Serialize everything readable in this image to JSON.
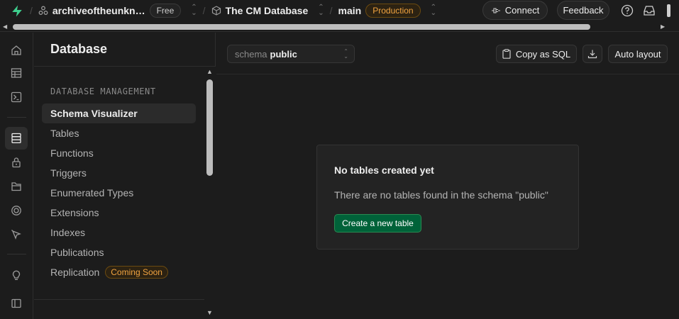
{
  "topbar": {
    "org_name": "archiveoftheunkn…",
    "org_plan": "Free",
    "project_name": "The CM Database",
    "branch_name": "main",
    "branch_env": "Production",
    "connect_label": "Connect",
    "feedback_label": "Feedback"
  },
  "sidemenu": {
    "title": "Database",
    "section_label": "DATABASE MANAGEMENT",
    "items": [
      {
        "label": "Schema Visualizer",
        "active": true
      },
      {
        "label": "Tables"
      },
      {
        "label": "Functions"
      },
      {
        "label": "Triggers"
      },
      {
        "label": "Enumerated Types"
      },
      {
        "label": "Extensions"
      },
      {
        "label": "Indexes"
      },
      {
        "label": "Publications"
      },
      {
        "label": "Replication",
        "badge": "Coming Soon"
      }
    ]
  },
  "toolbar": {
    "schema_key": "schema",
    "schema_value": "public",
    "copy_sql_label": "Copy as SQL",
    "auto_layout_label": "Auto layout"
  },
  "empty_state": {
    "title": "No tables created yet",
    "description": "There are no tables found in the schema \"public\"",
    "button_label": "Create a new table"
  },
  "colors": {
    "brand_green": "#3ecf8e",
    "production_orange": "#f0a340",
    "create_button_bg": "#006239"
  }
}
